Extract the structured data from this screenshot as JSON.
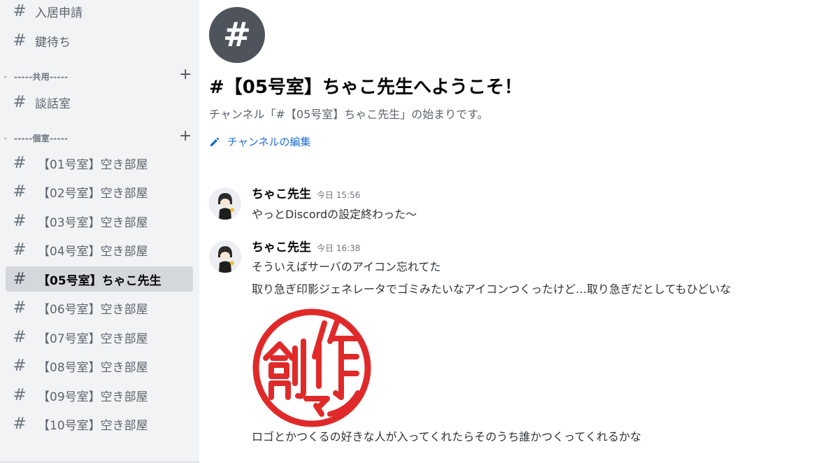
{
  "sidebar": {
    "top_channels": [
      "入居申請",
      "鍵待ち"
    ],
    "categories": [
      {
        "name": "-----共用-----",
        "chevron": "chevron-down-icon"
      },
      {
        "name": "-----個室-----",
        "chevron": "chevron-down-icon"
      }
    ],
    "shared_channels": [
      "談話室"
    ],
    "rooms": [
      "【01号室】空き部屋",
      "【02号室】空き部屋",
      "【03号室】空き部屋",
      "【04号室】空き部屋",
      "【05号室】ちゃこ先生",
      "【06号室】空き部屋",
      "【07号室】空き部屋",
      "【08号室】空き部屋",
      "【09号室】空き部屋",
      "【10号室】空き部屋"
    ],
    "selected_room": "【05号室】ちゃこ先生"
  },
  "main": {
    "channel_icon": "#",
    "welcome_title": "#【05号室】ちゃこ先生へようこそ！",
    "subtitle": "チャンネル「#【05号室】ちゃこ先生」の始まりです。",
    "edit_label": "チャンネルの編集"
  },
  "messages": [
    {
      "author": "ちゃこ先生",
      "time": "今日 15:56",
      "lines": [
        "やっとDiscordの設定終わった〜"
      ]
    },
    {
      "author": "ちゃこ先生",
      "time": "今日 16:38",
      "lines": [
        "そういえばサーバのアイコン忘れてた",
        "取り急ぎ印影ジェネレータでゴミみたいなアイコンつくったけど…取り急ぎだとしてもひどいな"
      ],
      "image_text": "創作マン",
      "after_image": "ロゴとかつくるの好きな人が入ってくれたらそのうち誰かつくってくれるかな"
    }
  ],
  "colors": {
    "accent_link": "#1f6fd1",
    "stamp_red": "#e02a2a",
    "selected_bg": "#d4d7dc",
    "sidebar_bg": "#f2f3f5"
  }
}
